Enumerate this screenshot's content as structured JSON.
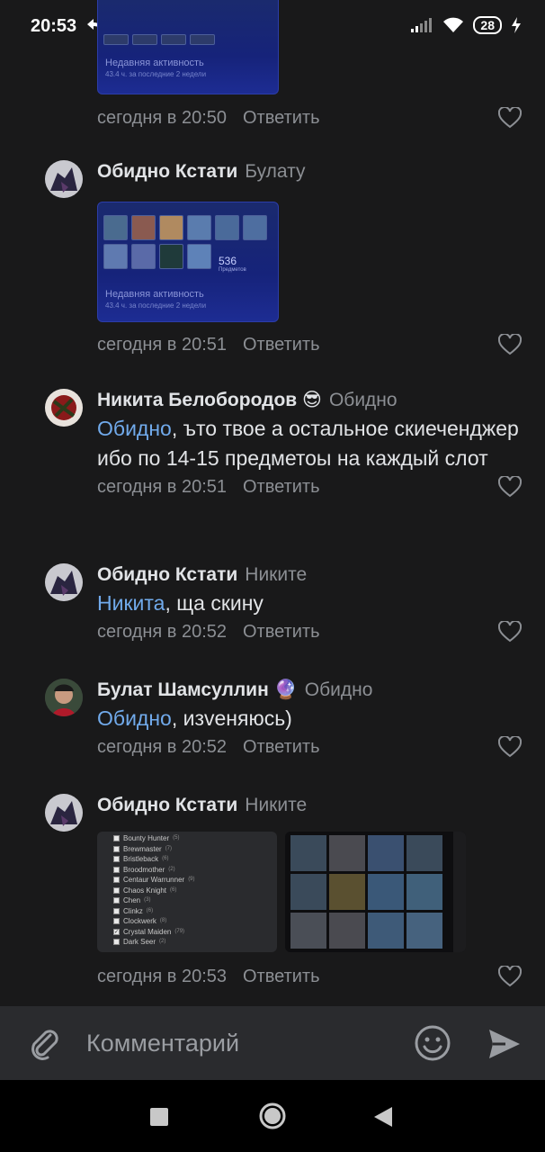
{
  "status_bar": {
    "time": "20:53",
    "battery": "28",
    "icons": [
      "reply-arrow-icon",
      "cloud-icon",
      "signal-icon",
      "wifi-icon",
      "charging-icon"
    ]
  },
  "comments": [
    {
      "id": "c0",
      "author": "",
      "reply_to": "",
      "activity_title": "Недавняя активность",
      "activity_sub": "43.4 ч. за последние 2 недели",
      "time": "сегодня в 20:50",
      "reply_label": "Ответить"
    },
    {
      "id": "c1",
      "author": "Обидно Кстати",
      "reply_to": "Булату",
      "card_count": "536",
      "card_count_label": "Предметов",
      "activity_title": "Недавняя активность",
      "activity_sub": "43.4 ч. за последние 2 недели",
      "time": "сегодня в 20:51",
      "reply_label": "Ответить"
    },
    {
      "id": "c2",
      "author": "Никита Белобородов",
      "author_emoji": "😎",
      "reply_to": "Обидно",
      "mention": "Обидно",
      "text": ", ъто твое а остальное скиеченджер ибо по 14-15 предметоы на каждый слот",
      "time": "сегодня в 20:51",
      "reply_label": "Ответить"
    },
    {
      "id": "c3",
      "author": "Обидно Кстати",
      "reply_to": "Никите",
      "mention": "Никита",
      "text": ", ща скину",
      "time": "сегодня в 20:52",
      "reply_label": "Ответить"
    },
    {
      "id": "c4",
      "author": "Булат Шамсуллин",
      "author_emoji": "🔮",
      "reply_to": "Обидно",
      "mention": "Обидно",
      "text": ", изveняюсь)",
      "time": "сегодня в 20:52",
      "reply_label": "Ответить"
    },
    {
      "id": "c5",
      "author": "Обидно Кстати",
      "reply_to": "Никите",
      "hero_list": [
        "Bounty Hunter",
        "Brewmaster",
        "Bristleback",
        "Broodmother",
        "Centaur Warrunner",
        "Chaos Knight",
        "Chen",
        "Clinkz",
        "Clockwerk",
        "Crystal Maiden",
        "Dark Seer"
      ],
      "hero_counts": [
        "(5)",
        "(7)",
        "(6)",
        "(2)",
        "(9)",
        "(6)",
        "(3)",
        "(6)",
        "(8)",
        "(79)",
        "(2)"
      ],
      "time": "сегодня в 20:53",
      "reply_label": "Ответить"
    }
  ],
  "input": {
    "placeholder": "Комментарий"
  },
  "colors": {
    "background": "#19191a",
    "mention": "#71aaeb",
    "secondary_text": "#8c8f94",
    "input_bar": "#2a2b2e"
  }
}
